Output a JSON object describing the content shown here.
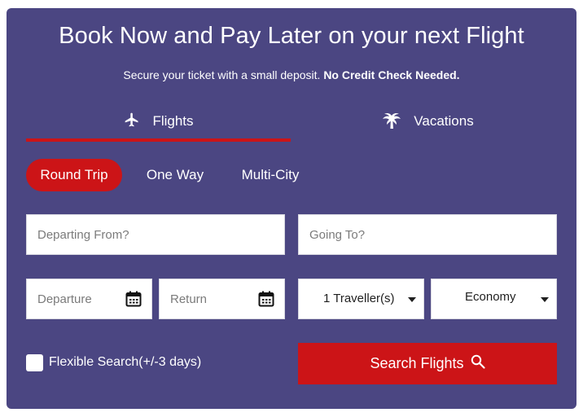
{
  "header": {
    "title": "Book Now and Pay Later on your next Flight",
    "subtitle": "Secure your ticket with a small deposit.",
    "subtitle_bold": "No Credit Check Needed."
  },
  "tabs": [
    {
      "label": "Flights",
      "icon": "airplane-icon",
      "active": true
    },
    {
      "label": "Vacations",
      "icon": "palm-tree-icon",
      "active": false
    }
  ],
  "trip_types": [
    {
      "label": "Round Trip",
      "selected": true
    },
    {
      "label": "One Way",
      "selected": false
    },
    {
      "label": "Multi-City",
      "selected": false
    }
  ],
  "form": {
    "from_placeholder": "Departing From?",
    "to_placeholder": "Going To?",
    "departure_placeholder": "Departure",
    "return_placeholder": "Return",
    "travellers": "1 Traveller(s)",
    "cabin_class": "Economy",
    "flexible_label": "Flexible Search(+/-3 days)",
    "search_label": "Search Flights"
  },
  "colors": {
    "panel": "#4b4682",
    "accent": "#cc1417"
  }
}
